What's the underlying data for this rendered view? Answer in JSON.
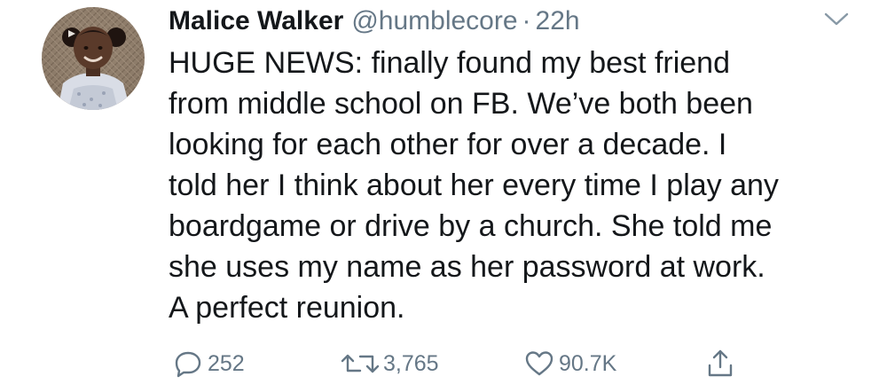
{
  "author": {
    "display_name": "Malice Walker",
    "handle": "@humblecore",
    "separator": "·",
    "time": "22h"
  },
  "tweet": {
    "lines": [
      "HUGE NEWS: finally found my best friend",
      "from middle school on FB. We’ve both been",
      "looking for each other for over a decade. I",
      "told her I think about her every time I play any",
      "boardgame or drive by a church. She told me",
      "she uses my name as her password at work.",
      "A perfect reunion."
    ]
  },
  "actions": {
    "reply": {
      "icon": "reply-icon",
      "count": "252"
    },
    "retweet": {
      "icon": "retweet-icon",
      "count": "3,765"
    },
    "like": {
      "icon": "heart-icon",
      "count": "90.7K"
    },
    "share": {
      "icon": "share-icon"
    }
  },
  "colors": {
    "text": "#14171a",
    "secondary": "#657786",
    "background": "#ffffff"
  }
}
